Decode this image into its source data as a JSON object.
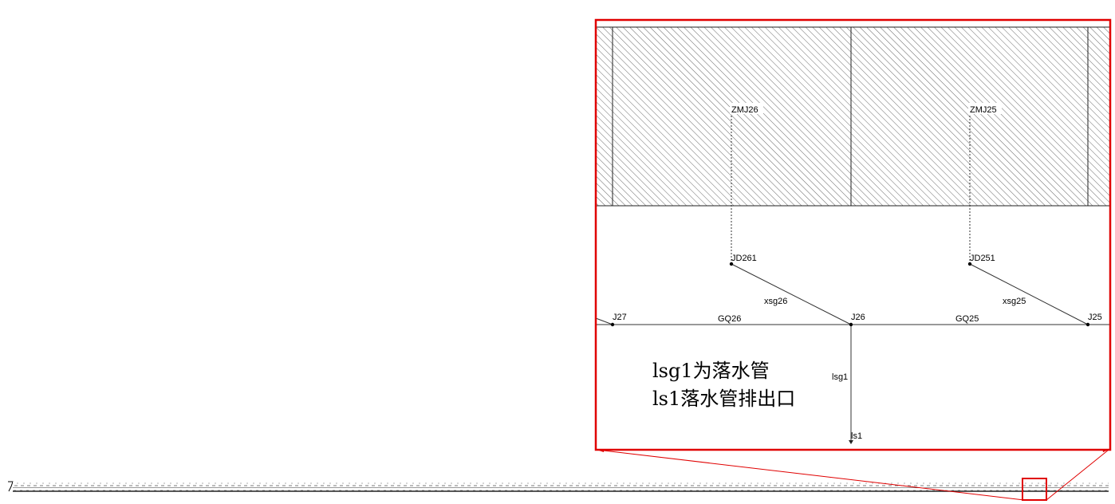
{
  "diagram": {
    "nodes": {
      "zmj26": "ZMJ26",
      "zmj25": "ZMJ25",
      "jd261": "JD261",
      "jd251": "JD251",
      "j27": "J27",
      "j26": "J26",
      "j25": "J25",
      "ls1": "ls1"
    },
    "pipes": {
      "xsg26": "xsg26",
      "xsg25": "xsg25",
      "gq26": "GQ26",
      "gq25": "GQ25",
      "lsg1": "lsg1"
    },
    "notes": {
      "line1": "lsg1为落水管",
      "line2": "ls1落水管排出口"
    },
    "colors": {
      "highlight": "#e00000",
      "line": "#222222",
      "hatch": "#444444"
    }
  }
}
